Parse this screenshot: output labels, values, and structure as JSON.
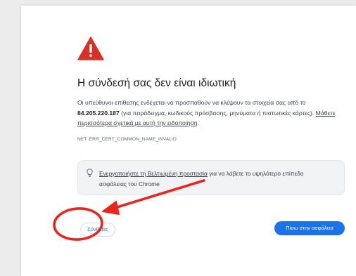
{
  "page": {
    "title": "Η σύνδεσή σας δεν είναι ιδιωτική",
    "intro_prefix": "Οι υπεύθυνοι επίθεσης ενδέχεται να προσπαθούν να κλέψουν τα στοιχεία σας από το ",
    "host": "84.205.220.187",
    "intro_suffix": " (για παράδειγμα, κωδικούς πρόσβασης, μηνύματα ή πιστωτικές κάρτες). ",
    "learn_more_link": "Μάθετε περισσότερα σχετικά με αυτή την ειδοποίηση",
    "intro_end": ".",
    "error_code": "NET::ERR_CERT_COMMON_NAME_INVALID"
  },
  "protection": {
    "link": "Ενεργοποιήστε τη Βελτιωμένη προστασία",
    "text": " για να λάβετε το υψηλότερο επίπεδο ασφάλειας του Chrome"
  },
  "buttons": {
    "details": "Σύνθετες",
    "back": "Πίσω στην ασφάλεια"
  },
  "icons": {
    "warning": "warning-triangle-icon",
    "bulb": "lightbulb-icon"
  },
  "colors": {
    "warning_red": "#d93025",
    "primary_blue": "#1a73e8",
    "annotation_red": "#e8261c"
  }
}
